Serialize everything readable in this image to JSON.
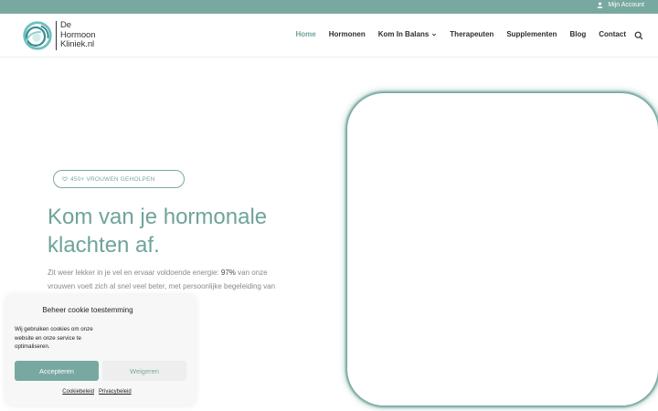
{
  "topbar": {
    "account_label": "Mijn Account",
    "account_icon": "user-icon"
  },
  "logo": {
    "line1": "De",
    "line2": "Hormoon",
    "line3": "Kliniek.nl"
  },
  "nav": {
    "items": [
      {
        "label": "Home",
        "active": true
      },
      {
        "label": "Hormonen"
      },
      {
        "label": "Kom In Balans",
        "has_dropdown": true
      },
      {
        "label": "Therapeuten"
      },
      {
        "label": "Supplementen"
      },
      {
        "label": "Blog"
      },
      {
        "label": "Contact"
      }
    ],
    "search_icon": "search-icon"
  },
  "hero": {
    "badge": "450+ VROUWEN GEHOLPEN",
    "title_line1": "Kom van je hormonale",
    "title_line2": "klachten af.",
    "text_before": "Zit weer lekker in je vel en ervaar voldoende energie: ",
    "text_highlight": "97%",
    "text_after": " van onze vrouwen voelt zich al snel veel beter, met persoonlijke begeleiding van"
  },
  "cookie": {
    "title": "Beheer cookie toestemming",
    "text": "Wij gebruiken cookies om onze website en onze service te optimaliseren.",
    "accept": "Accepteren",
    "deny": "Weigeren",
    "link1": "Cookiebeleid",
    "link2": "Privacybeleid"
  },
  "colors": {
    "accent": "#77a9a1",
    "nav_active": "#6fa39b",
    "text_dark": "#2d2d2d"
  }
}
